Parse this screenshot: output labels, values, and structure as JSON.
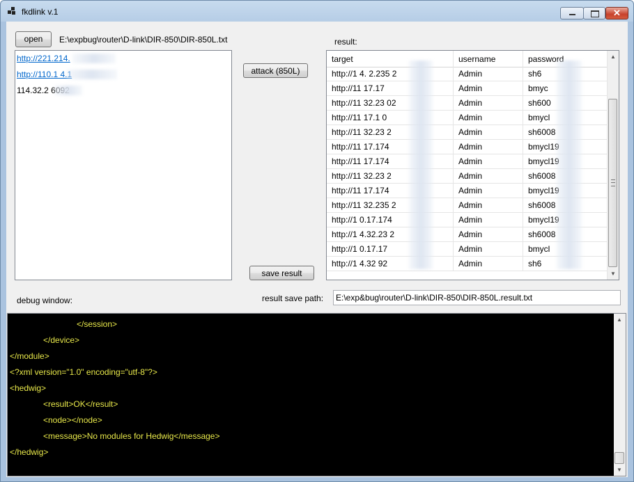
{
  "window": {
    "title": "fkdlink  v.1",
    "minimize": "–",
    "maximize": "□",
    "close": "✕"
  },
  "top": {
    "open_label": "open",
    "file_path": "E:\\expbug\\router\\D-link\\DIR-850\\DIR-850L.txt"
  },
  "targets": [
    {
      "text": "http://221.214.",
      "link": true
    },
    {
      "text": "http://110.1     4.1",
      "link": true
    },
    {
      "text": "114.32.2          6092",
      "link": false
    }
  ],
  "attack_label": "attack  (850L)",
  "save_label": "save result",
  "result_label": "result:",
  "grid": {
    "columns": [
      "target",
      "username",
      "password"
    ],
    "rows": [
      [
        "http://1  4.   2.235           2",
        "Admin",
        "sh6"
      ],
      [
        "http://11   17.17",
        "Admin",
        "bmyc"
      ],
      [
        "http://11   32.23            02",
        "Admin",
        "sh600"
      ],
      [
        "http://11   17.1            0",
        "Admin",
        "bmycl"
      ],
      [
        "http://11   32.23            2",
        "Admin",
        "sh6008"
      ],
      [
        "http://11   17.174",
        "Admin",
        "bmycl19"
      ],
      [
        "http://11   17.174",
        "Admin",
        "bmycl19"
      ],
      [
        "http://11   32.23            2",
        "Admin",
        "sh6008"
      ],
      [
        "http://11   17.174",
        "Admin",
        "bmycl19"
      ],
      [
        "http://11   32.235           2",
        "Admin",
        "sh6008"
      ],
      [
        "http://1   0.17.174",
        "Admin",
        "bmycl19"
      ],
      [
        "http://1   4.32.23           2",
        "Admin",
        "sh6008"
      ],
      [
        "http://1   0.17.17",
        "Admin",
        "bmycl"
      ],
      [
        "http://1   4.32               92",
        "Admin",
        "sh6"
      ]
    ]
  },
  "debug_label": "debug window:",
  "save_path_label": "result save path:",
  "save_path": "E:\\exp&bug\\router\\D-link\\DIR-850\\DIR-850L.result.txt",
  "console_lines": [
    "</session>",
    "</device>",
    "</module>",
    "<?xml version=\"1.0\" encoding=\"utf-8\"?>",
    "<hedwig>",
    "<result>OK</result>",
    "<node></node>",
    "<message>No modules for Hedwig</message>",
    "</hedwig>"
  ],
  "colors": {
    "console_text": "#e8e84a",
    "link": "#0066cc"
  }
}
